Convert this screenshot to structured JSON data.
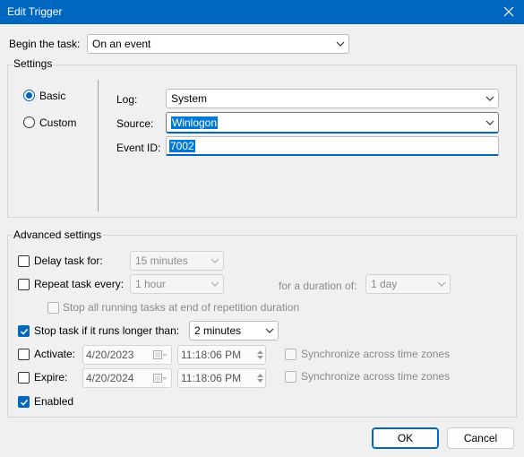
{
  "window": {
    "title": "Edit Trigger",
    "close_icon": "close-icon"
  },
  "begin": {
    "label": "Begin the task:",
    "value": "On an event"
  },
  "settings": {
    "group_label": "Settings",
    "radio_basic": "Basic",
    "radio_custom": "Custom",
    "selected": "Basic",
    "log_label": "Log:",
    "log_value": "System",
    "source_label": "Source:",
    "source_value": "Winlogon",
    "eventid_label": "Event ID:",
    "eventid_value": "7002"
  },
  "advanced": {
    "group_label": "Advanced settings",
    "delay_label": "Delay task for:",
    "delay_value": "15 minutes",
    "delay_checked": false,
    "repeat_label": "Repeat task every:",
    "repeat_value": "1 hour",
    "repeat_checked": false,
    "duration_label": "for a duration of:",
    "duration_value": "1 day",
    "stop_all_label": "Stop all running tasks at end of repetition duration",
    "stop_long_label": "Stop task if it runs longer than:",
    "stop_long_value": "2 minutes",
    "stop_long_checked": true,
    "activate_label": "Activate:",
    "activate_date": "4/20/2023",
    "activate_time": "11:18:06 PM",
    "expire_label": "Expire:",
    "expire_date": "4/20/2024",
    "expire_time": "11:18:06 PM",
    "sync_label": "Synchronize across time zones",
    "enabled_label": "Enabled",
    "enabled_checked": true
  },
  "buttons": {
    "ok": "OK",
    "cancel": "Cancel"
  },
  "colors": {
    "accent": "#0067c0",
    "selection": "#0078d7"
  }
}
